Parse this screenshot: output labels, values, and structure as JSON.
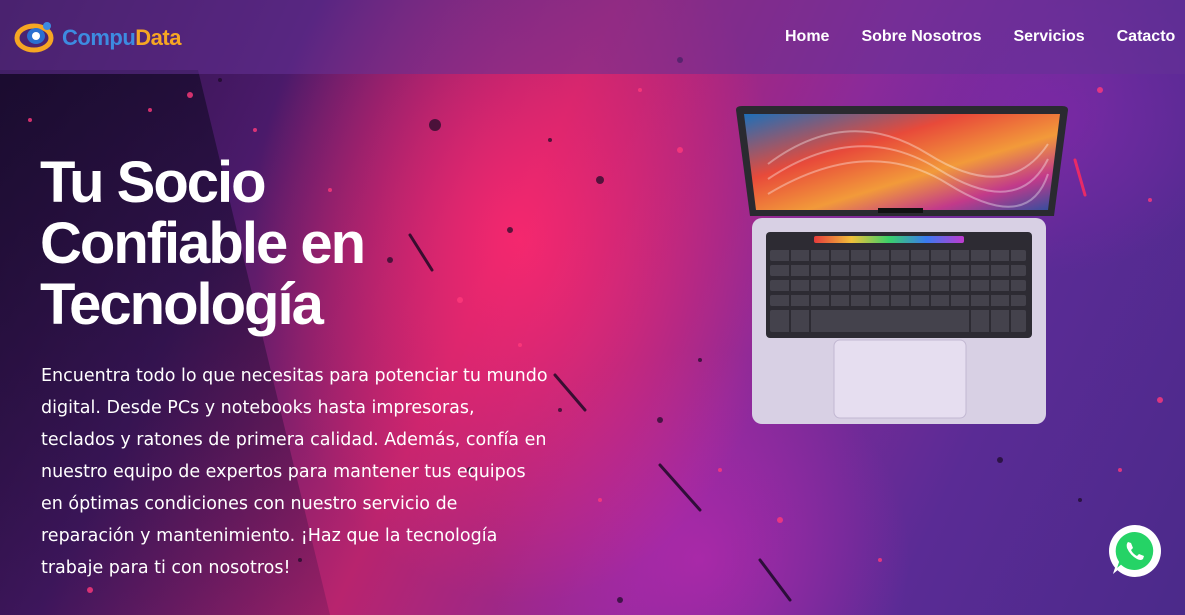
{
  "header": {
    "logo": {
      "part1": "Compu",
      "part2": "Data"
    },
    "nav": [
      {
        "label": "Home"
      },
      {
        "label": "Sobre Nosotros"
      },
      {
        "label": "Servicios"
      },
      {
        "label": "Catacto"
      }
    ]
  },
  "hero": {
    "title": "Tu Socio Confiable en Tecnología",
    "description": "Encuentra todo lo que necesitas para potenciar tu mundo digital. Desde PCs y notebooks hasta impresoras, teclados y ratones de primera calidad. Además, confía en nuestro equipo de expertos para mantener tus equipos en óptimas condiciones con nuestro servicio de reparación y mantenimiento. ¡Haz que la tecnología trabaje para ti con nosotros!"
  },
  "icons": {
    "logo": "compudata-logo-icon",
    "laptop": "laptop-image",
    "whatsapp": "whatsapp-icon"
  },
  "colors": {
    "logo_blue": "#3d8be0",
    "logo_orange": "#f6a623",
    "whatsapp_green": "#25d366"
  }
}
